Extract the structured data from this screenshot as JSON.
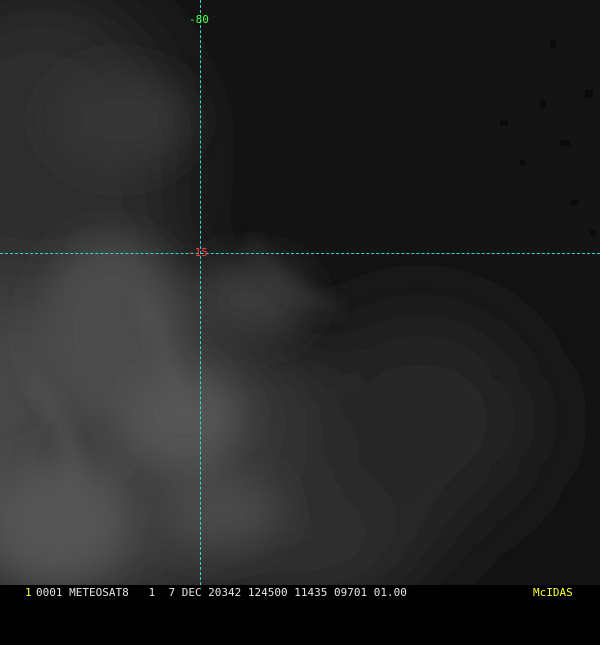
{
  "colors": {
    "grid": "#2fd6d6",
    "lon_label": "#4cff4c",
    "lat_label": "#ff3b3b",
    "frame_number": "#ffff33",
    "status_text": "#e6e6e6",
    "brand": "#ffff33",
    "background": "#161616"
  },
  "grid": {
    "longitude_label": "-80",
    "latitude_label": "-15"
  },
  "status_bar": {
    "frame_number": "1",
    "text": "0001 METEOSAT8   1  7 DEC 20342 124500 11435 09701 01.00",
    "brand": "McIDAS"
  }
}
